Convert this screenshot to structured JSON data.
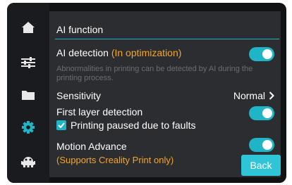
{
  "sidebar": {
    "items": [
      {
        "icon": "home-icon"
      },
      {
        "icon": "sliders-icon"
      },
      {
        "icon": "folder-icon"
      },
      {
        "icon": "gear-icon",
        "active": true
      },
      {
        "icon": "robot-icon"
      }
    ],
    "active_color": "#1fb5c6",
    "icon_color": "#e8e8e8"
  },
  "panel": {
    "title": "AI function",
    "ai_detection": {
      "label": "AI detection",
      "status": "(In optimization)",
      "description": "Abnormalities in printing can be detected by AI during the printing process.",
      "enabled": true
    },
    "sensitivity": {
      "label": "Sensitivity",
      "value": "Normal"
    },
    "first_layer": {
      "label": "First layer detection",
      "enabled": true,
      "pause_on_fault": {
        "label": "Printing paused due to faults",
        "checked": true
      }
    },
    "motion_advance": {
      "label": "Motion Advance",
      "note": "(Supports Creality Print only)",
      "enabled": true
    },
    "back_label": "Back"
  },
  "colors": {
    "accent": "#1fb5c6",
    "warning": "#f5a623",
    "panel": "#2c2d30"
  }
}
